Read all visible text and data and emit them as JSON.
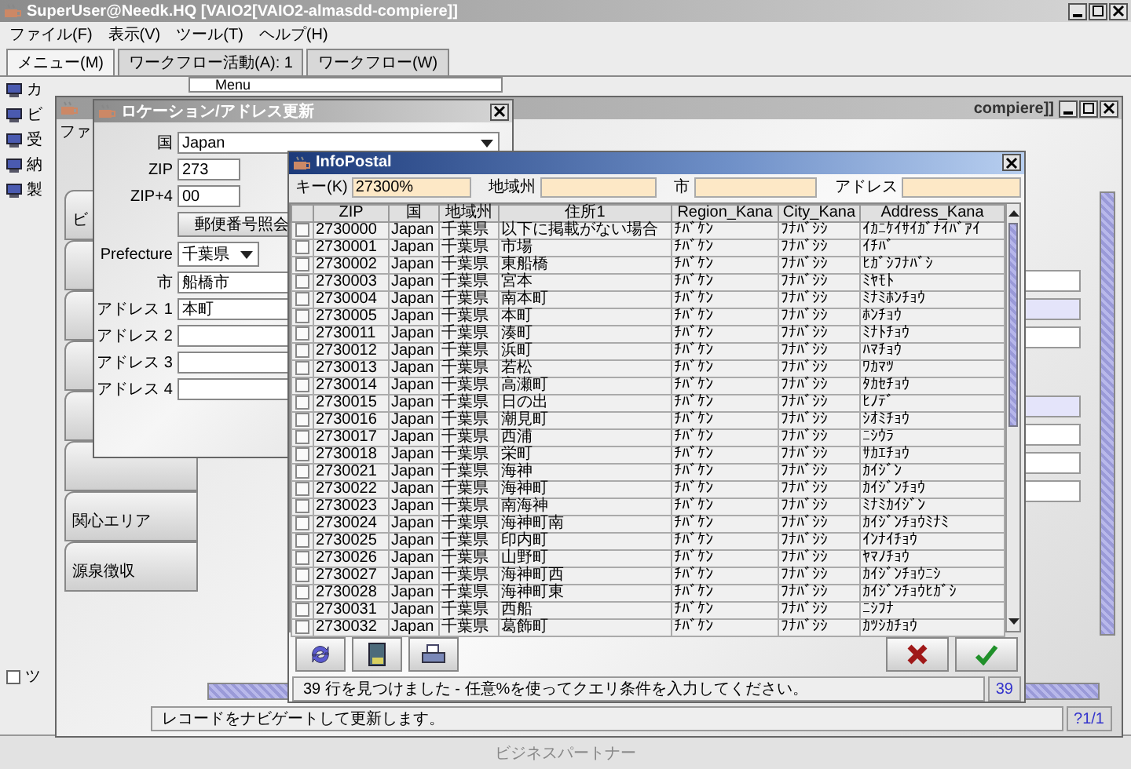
{
  "app_window": {
    "title": "SuperUser@Needk.HQ [VAIO2[VAIO2-almasdd-compiere]]",
    "menu": [
      "ファイル(F)",
      "表示(V)",
      "ツール(T)",
      "ヘルプ(H)"
    ],
    "tabs": [
      {
        "label": "メニュー(M)",
        "selected": true
      },
      {
        "label": "ワークフロー活動(A): 1",
        "selected": false
      },
      {
        "label": "ワークフロー(W)",
        "selected": false
      }
    ],
    "sidebar_items": [
      "カ",
      "ビ",
      "受",
      "納",
      "製"
    ],
    "menu_field": "Menu",
    "checkbox": {
      "label": "ツ",
      "checked": false
    },
    "footer": "ビジネスパートナー"
  },
  "partner_window": {
    "title": "compiere]]",
    "menu": [
      "ファ"
    ],
    "side_tabs": [
      {
        "kind": "tab",
        "label": "ビ"
      },
      {
        "kind": "blank"
      },
      {
        "kind": "blank"
      },
      {
        "kind": "blank"
      },
      {
        "kind": "blank"
      },
      {
        "kind": "blank"
      },
      {
        "kind": "tab",
        "label": "関心エリア"
      },
      {
        "kind": "tab",
        "label": "源泉徴収"
      }
    ],
    "status": "レコードをナビゲートして更新します。",
    "page": "?1/1"
  },
  "location_dialog": {
    "title": "ロケーション/アドレス更新",
    "fields": [
      {
        "kind": "select",
        "label": "国",
        "value": "Japan"
      },
      {
        "kind": "short",
        "label": "ZIP",
        "value": "273"
      },
      {
        "kind": "short",
        "label": "ZIP+4",
        "value": "00"
      },
      {
        "kind": "button",
        "text": "郵便番号照会"
      },
      {
        "kind": "small_select",
        "label": "Prefecture",
        "value": "千葉県"
      },
      {
        "kind": "text",
        "label": "市",
        "value": "船橋市"
      },
      {
        "kind": "text",
        "label": "アドレス 1",
        "value": "本町"
      },
      {
        "kind": "text",
        "label": "アドレス 2"
      },
      {
        "kind": "text",
        "label": "アドレス 3"
      },
      {
        "kind": "text",
        "label": "アドレス 4"
      }
    ]
  },
  "info_postal": {
    "title": "InfoPostal",
    "search": [
      {
        "label": "キー(K)",
        "value": "27300%"
      },
      {
        "label": "地域州"
      },
      {
        "label": "市"
      },
      {
        "label": "アドレス"
      }
    ],
    "columns": [
      "ZIP",
      "国",
      "地域州",
      "住所1",
      "Region_Kana",
      "City_Kana",
      "Address_Kana"
    ],
    "rows": [
      {
        "checked": false,
        "cells": [
          "2730000",
          "Japan",
          "千葉県",
          "以下に掲載がない場合",
          "ﾁﾊﾞｹﾝ",
          "ﾌﾅﾊﾞｼｼ",
          "ｲｶﾆｹｲｻｲｶﾞﾅｲﾊﾞｱｲ"
        ]
      },
      {
        "checked": false,
        "cells": [
          "2730001",
          "Japan",
          "千葉県",
          "市場",
          "ﾁﾊﾞｹﾝ",
          "ﾌﾅﾊﾞｼｼ",
          "ｲﾁﾊﾞ"
        ]
      },
      {
        "checked": false,
        "cells": [
          "2730002",
          "Japan",
          "千葉県",
          "東船橋",
          "ﾁﾊﾞｹﾝ",
          "ﾌﾅﾊﾞｼｼ",
          "ﾋｶﾞｼﾌﾅﾊﾞｼ"
        ]
      },
      {
        "checked": false,
        "cells": [
          "2730003",
          "Japan",
          "千葉県",
          "宮本",
          "ﾁﾊﾞｹﾝ",
          "ﾌﾅﾊﾞｼｼ",
          "ﾐﾔﾓﾄ"
        ]
      },
      {
        "checked": false,
        "cells": [
          "2730004",
          "Japan",
          "千葉県",
          "南本町",
          "ﾁﾊﾞｹﾝ",
          "ﾌﾅﾊﾞｼｼ",
          "ﾐﾅﾐﾎﾝﾁｮｳ"
        ]
      },
      {
        "checked": false,
        "cells": [
          "2730005",
          "Japan",
          "千葉県",
          "本町",
          "ﾁﾊﾞｹﾝ",
          "ﾌﾅﾊﾞｼｼ",
          "ﾎﾝﾁｮｳ"
        ]
      },
      {
        "checked": false,
        "cells": [
          "2730011",
          "Japan",
          "千葉県",
          "湊町",
          "ﾁﾊﾞｹﾝ",
          "ﾌﾅﾊﾞｼｼ",
          "ﾐﾅﾄﾁｮｳ"
        ]
      },
      {
        "checked": false,
        "cells": [
          "2730012",
          "Japan",
          "千葉県",
          "浜町",
          "ﾁﾊﾞｹﾝ",
          "ﾌﾅﾊﾞｼｼ",
          "ﾊﾏﾁｮｳ"
        ]
      },
      {
        "checked": false,
        "cells": [
          "2730013",
          "Japan",
          "千葉県",
          "若松",
          "ﾁﾊﾞｹﾝ",
          "ﾌﾅﾊﾞｼｼ",
          "ﾜｶﾏﾂ"
        ]
      },
      {
        "checked": false,
        "cells": [
          "2730014",
          "Japan",
          "千葉県",
          "高瀬町",
          "ﾁﾊﾞｹﾝ",
          "ﾌﾅﾊﾞｼｼ",
          "ﾀｶｾﾁｮｳ"
        ]
      },
      {
        "checked": false,
        "cells": [
          "2730015",
          "Japan",
          "千葉県",
          "日の出",
          "ﾁﾊﾞｹﾝ",
          "ﾌﾅﾊﾞｼｼ",
          "ﾋﾉﾃﾞ"
        ]
      },
      {
        "checked": false,
        "cells": [
          "2730016",
          "Japan",
          "千葉県",
          "潮見町",
          "ﾁﾊﾞｹﾝ",
          "ﾌﾅﾊﾞｼｼ",
          "ｼｵﾐﾁｮｳ"
        ]
      },
      {
        "checked": false,
        "cells": [
          "2730017",
          "Japan",
          "千葉県",
          "西浦",
          "ﾁﾊﾞｹﾝ",
          "ﾌﾅﾊﾞｼｼ",
          "ﾆｼｳﾗ"
        ]
      },
      {
        "checked": false,
        "cells": [
          "2730018",
          "Japan",
          "千葉県",
          "栄町",
          "ﾁﾊﾞｹﾝ",
          "ﾌﾅﾊﾞｼｼ",
          "ｻｶｴﾁｮｳ"
        ]
      },
      {
        "checked": false,
        "cells": [
          "2730021",
          "Japan",
          "千葉県",
          "海神",
          "ﾁﾊﾞｹﾝ",
          "ﾌﾅﾊﾞｼｼ",
          "ｶｲｼﾞﾝ"
        ]
      },
      {
        "checked": false,
        "cells": [
          "2730022",
          "Japan",
          "千葉県",
          "海神町",
          "ﾁﾊﾞｹﾝ",
          "ﾌﾅﾊﾞｼｼ",
          "ｶｲｼﾞﾝﾁｮｳ"
        ]
      },
      {
        "checked": false,
        "cells": [
          "2730023",
          "Japan",
          "千葉県",
          "南海神",
          "ﾁﾊﾞｹﾝ",
          "ﾌﾅﾊﾞｼｼ",
          "ﾐﾅﾐｶｲｼﾞﾝ"
        ]
      },
      {
        "checked": false,
        "cells": [
          "2730024",
          "Japan",
          "千葉県",
          "海神町南",
          "ﾁﾊﾞｹﾝ",
          "ﾌﾅﾊﾞｼｼ",
          "ｶｲｼﾞﾝﾁｮｳﾐﾅﾐ"
        ]
      },
      {
        "checked": false,
        "cells": [
          "2730025",
          "Japan",
          "千葉県",
          "印内町",
          "ﾁﾊﾞｹﾝ",
          "ﾌﾅﾊﾞｼｼ",
          "ｲﾝﾅｲﾁｮｳ"
        ]
      },
      {
        "checked": false,
        "cells": [
          "2730026",
          "Japan",
          "千葉県",
          "山野町",
          "ﾁﾊﾞｹﾝ",
          "ﾌﾅﾊﾞｼｼ",
          "ﾔﾏﾉﾁｮｳ"
        ]
      },
      {
        "checked": false,
        "cells": [
          "2730027",
          "Japan",
          "千葉県",
          "海神町西",
          "ﾁﾊﾞｹﾝ",
          "ﾌﾅﾊﾞｼｼ",
          "ｶｲｼﾞﾝﾁｮｳﾆｼ"
        ]
      },
      {
        "checked": false,
        "cells": [
          "2730028",
          "Japan",
          "千葉県",
          "海神町東",
          "ﾁﾊﾞｹﾝ",
          "ﾌﾅﾊﾞｼｼ",
          "ｶｲｼﾞﾝﾁｮｳﾋｶﾞｼ"
        ]
      },
      {
        "checked": false,
        "cells": [
          "2730031",
          "Japan",
          "千葉県",
          "西船",
          "ﾁﾊﾞｹﾝ",
          "ﾌﾅﾊﾞｼｼ",
          "ﾆｼﾌﾅ"
        ]
      },
      {
        "checked": false,
        "cells": [
          "2730032",
          "Japan",
          "千葉県",
          "葛飾町",
          "ﾁﾊﾞｹﾝ",
          "ﾌﾅﾊﾞｼｼ",
          "ｶﾂｼｶﾁｮｳ"
        ]
      }
    ],
    "status": "39 行を見つけました - 任意%を使ってクエリ条件を入力してください。",
    "count": "39"
  }
}
